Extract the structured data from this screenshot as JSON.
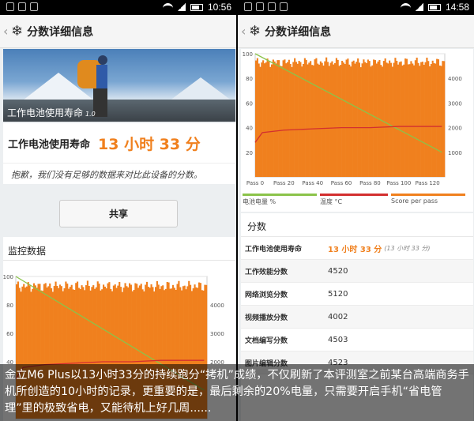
{
  "left_screen": {
    "status_time": "10:56",
    "title": "分数详细信息",
    "hero_caption": "工作电池使用寿命",
    "hero_version": "1.0",
    "result_label": "工作电池使用寿命",
    "result_value": "13 小时 33 分",
    "note": "抱歉，我们没有足够的数据来对比此设备的分数。",
    "share_label": "共享",
    "monitor_title": "监控数据"
  },
  "right_screen": {
    "status_time": "14:58",
    "title": "分数详细信息",
    "legend": [
      {
        "label": "电池电量 %",
        "color": "#8bc34a"
      },
      {
        "label": "温度 °C",
        "color": "#d32f2f"
      },
      {
        "label": "Score per pass",
        "color": "#f0801e"
      }
    ],
    "scores_title": "分数",
    "scores": [
      {
        "label": "工作电池使用寿命",
        "value": "13 小时 33 分",
        "sub": "(13 小时 33 分)",
        "main": true
      },
      {
        "label": "工作效能分数",
        "value": "4520"
      },
      {
        "label": "网络浏览分数",
        "value": "5120"
      },
      {
        "label": "视频播放分数",
        "value": "4002"
      },
      {
        "label": "文档编写分数",
        "value": "4503"
      },
      {
        "label": "图片编辑分数",
        "value": "4523"
      }
    ]
  },
  "caption": "金立M6 Plus以13小时33分的持续跑分“拷机”成绩，不仅刷新了本评测室之前某台高端商务手机所创造的10小时的记录，更重要的是，最后剩余的20%电量，只需要开启手机“省电管理”里的极致省电，又能待机上好几周......",
  "chart_data": [
    {
      "type": "bar",
      "series": [
        {
          "name": "电池电量 %",
          "type": "line",
          "color": "#8bc34a",
          "x": [
            0,
            130
          ],
          "y": [
            100,
            20
          ]
        },
        {
          "name": "温度 °C",
          "type": "line",
          "color": "#d32f2f",
          "x": [
            0,
            5,
            20,
            40,
            60,
            80,
            100,
            130
          ],
          "y": [
            28,
            36,
            38,
            39,
            40,
            40,
            41,
            41
          ]
        },
        {
          "name": "Score per pass",
          "type": "bar",
          "color": "#f0801e",
          "level_pct": 93
        }
      ],
      "x_ticks": [
        "Pass 0",
        "Pass 20",
        "Pass 40",
        "Pass 60",
        "Pass 80",
        "Pass 100",
        "Pass 120"
      ],
      "y_left_ticks": [
        20,
        40,
        60,
        80,
        100
      ],
      "y_right_ticks": [
        1000,
        2000,
        3000,
        4000
      ],
      "xlim": [
        0,
        132
      ],
      "ylim_left": [
        0,
        100
      ],
      "ylim_right": [
        0,
        5000
      ],
      "grid": true
    },
    {
      "type": "bar",
      "series": [
        {
          "name": "电池电量 %",
          "type": "line",
          "color": "#8bc34a",
          "x": [
            0,
            130
          ],
          "y": [
            100,
            20
          ]
        },
        {
          "name": "温度 °C",
          "type": "line",
          "color": "#d32f2f",
          "x": [
            0,
            5,
            20,
            40,
            60,
            80,
            100,
            130
          ],
          "y": [
            28,
            36,
            38,
            39,
            40,
            40,
            41,
            41
          ]
        },
        {
          "name": "Score per pass",
          "type": "bar",
          "color": "#f0801e",
          "level_pct": 93
        }
      ],
      "y_left_ticks": [
        40,
        60,
        80,
        100
      ],
      "y_right_ticks": [
        2000,
        3000,
        4000
      ],
      "ylim_left": [
        0,
        100
      ],
      "ylim_right": [
        0,
        5000
      ],
      "grid": true
    }
  ]
}
